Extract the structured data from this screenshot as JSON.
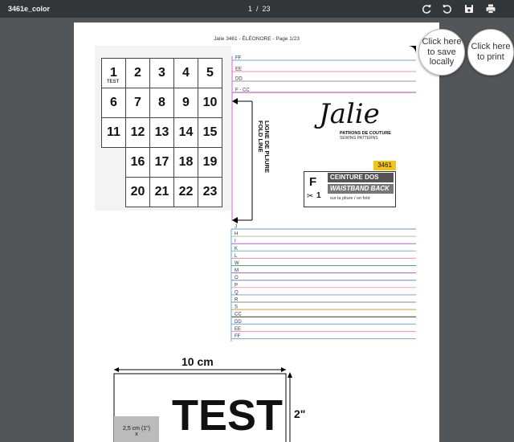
{
  "toolbar": {
    "title": "3461e_color",
    "page_current": "1",
    "page_total": "23",
    "icons": [
      "reload-icon",
      "rotate-icon",
      "save-icon",
      "print-icon"
    ]
  },
  "callouts": {
    "save": "Click here to save locally",
    "print": "Click here to print"
  },
  "page": {
    "header": "Jalie 3461 - ÉLÉONORE - Page 1/23",
    "grid_numbers": [
      "1",
      "2",
      "3",
      "4",
      "5",
      "6",
      "7",
      "8",
      "9",
      "10",
      "11",
      "12",
      "13",
      "14",
      "15",
      "16",
      "17",
      "18",
      "19",
      "20",
      "21",
      "22",
      "23"
    ],
    "grid_test_label": "TEST",
    "size_labels_top": [
      "FF",
      "EE",
      "DD",
      "F - CC"
    ],
    "size_labels_bottom": [
      "J",
      "H",
      "I",
      "K",
      "L",
      "W",
      "M",
      "O",
      "P",
      "Q",
      "R",
      "S",
      "CC",
      "DD",
      "EE",
      "FF"
    ],
    "fold_line_fr": "LIGNE DE PLIURE",
    "fold_line_en": "FOLD LINE",
    "brand": "Jalie",
    "brand_sub_fr": "PATRONS DE COUTURE",
    "brand_sub_en": "SEWING PATTERNS",
    "piece": {
      "number": "3461",
      "letter": "F",
      "cut_count": "1",
      "name_fr": "CEINTURE DOS",
      "name_en": "WAISTBAND BACK",
      "note": "sur la pliure / on fold"
    },
    "test_square": {
      "width_label": "10 cm",
      "height_label": "2\"",
      "big_label": "TEST",
      "small_label": "2,5 cm (1\")",
      "small_label_2": "x"
    }
  },
  "colors": {
    "toolbar": "#323639",
    "background": "#525659",
    "accent_yellow": "#f2c318",
    "piece_dark": "#555555"
  }
}
